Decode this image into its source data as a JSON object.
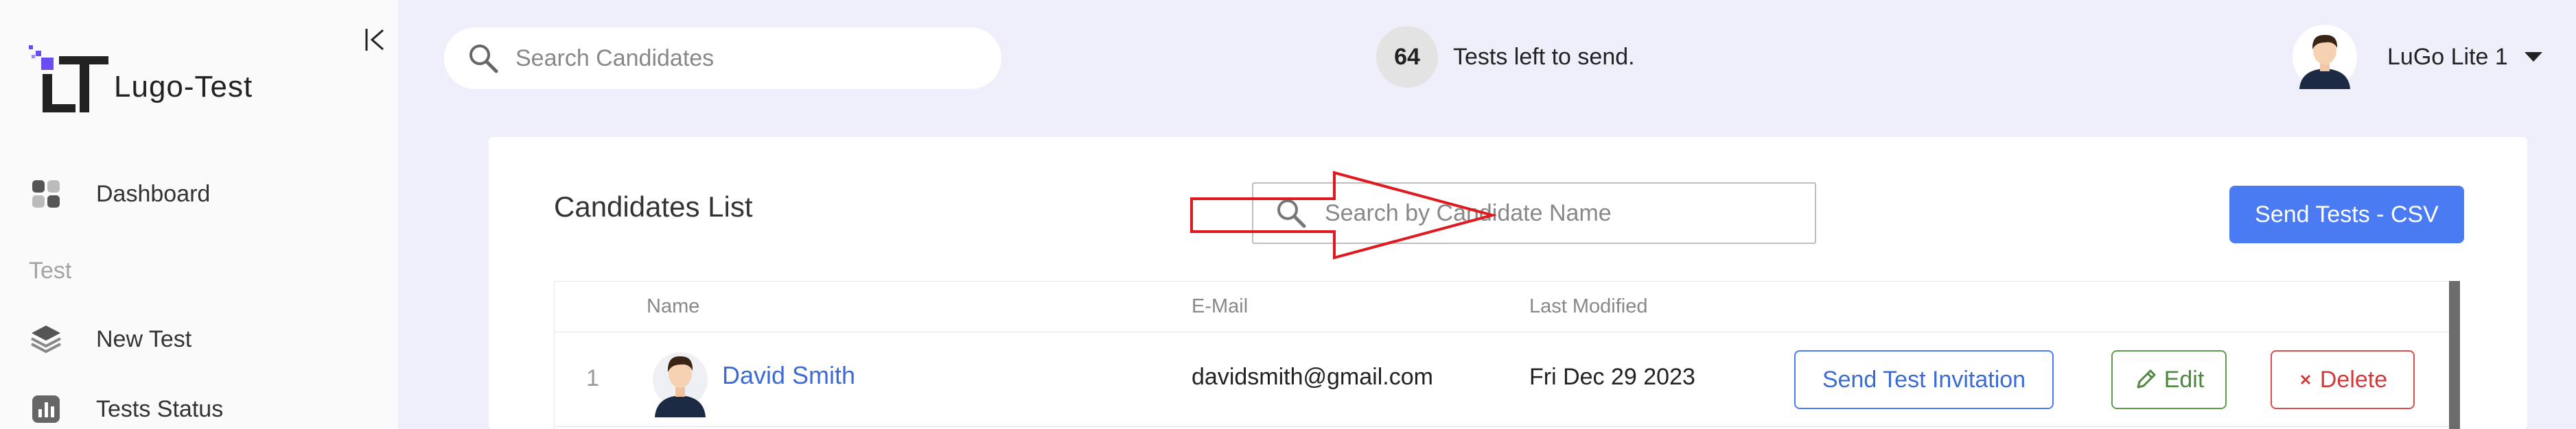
{
  "sidebar": {
    "logo_text": "Lugo-Test",
    "items": [
      {
        "label": "Dashboard",
        "icon": "dashboard-icon"
      },
      {
        "label": "New Test",
        "icon": "layers-icon"
      },
      {
        "label": "Tests Status",
        "icon": "bar-chart-icon"
      }
    ],
    "section_label": "Test"
  },
  "header": {
    "search_placeholder": "Search Candidates",
    "tests_left_count": "64",
    "tests_left_text": "Tests left to send.",
    "user_name": "LuGo Lite 1"
  },
  "main": {
    "title": "Candidates List",
    "search_placeholder": "Search by Candidate Name",
    "send_csv_label": "Send Tests - CSV",
    "table": {
      "headers": [
        "Name",
        "E-Mail",
        "Last Modified"
      ],
      "rows": [
        {
          "index": "1",
          "name": "David Smith",
          "email": "davidsmith@gmail.com",
          "last_modified": "Fri Dec 29 2023"
        }
      ]
    },
    "actions": {
      "invite_label": "Send Test Invitation",
      "edit_label": "Edit",
      "delete_label": "Delete"
    }
  },
  "colors": {
    "accent": "#4b7bf3",
    "edit": "#5c9a4c",
    "delete": "#d94a4a",
    "annotation_arrow": "#e0191f"
  }
}
